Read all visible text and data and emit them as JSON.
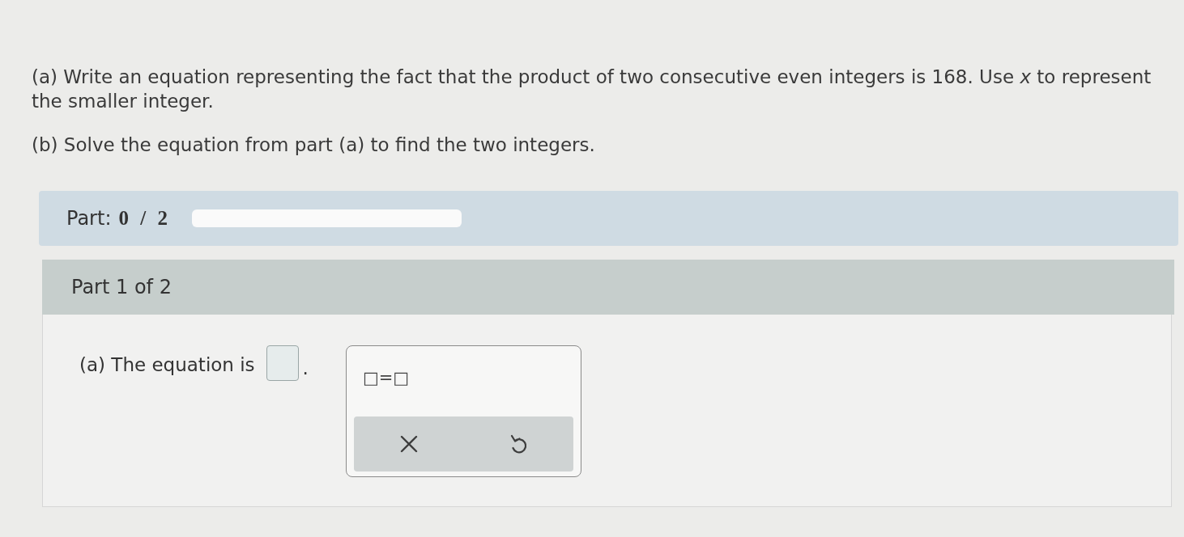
{
  "question": {
    "parts": [
      {
        "text": "(a) Write an equation representing the fact that the product of two consecutive even integers is 168. Use *x* to represent the smaller integer."
      },
      {
        "text": "(b) Solve the equation from part (a) to find the two integers."
      }
    ]
  },
  "progress": {
    "label": "Part:",
    "value": "0 / 2",
    "level": 0
  },
  "part": {
    "title": "Part 1 of 2",
    "prompt": "(a) The equation is",
    "suffix": "."
  },
  "palette": {
    "templates": [
      "□=□"
    ],
    "buttons": [
      {
        "kind": "clear"
      },
      {
        "kind": "undo"
      }
    ]
  }
}
